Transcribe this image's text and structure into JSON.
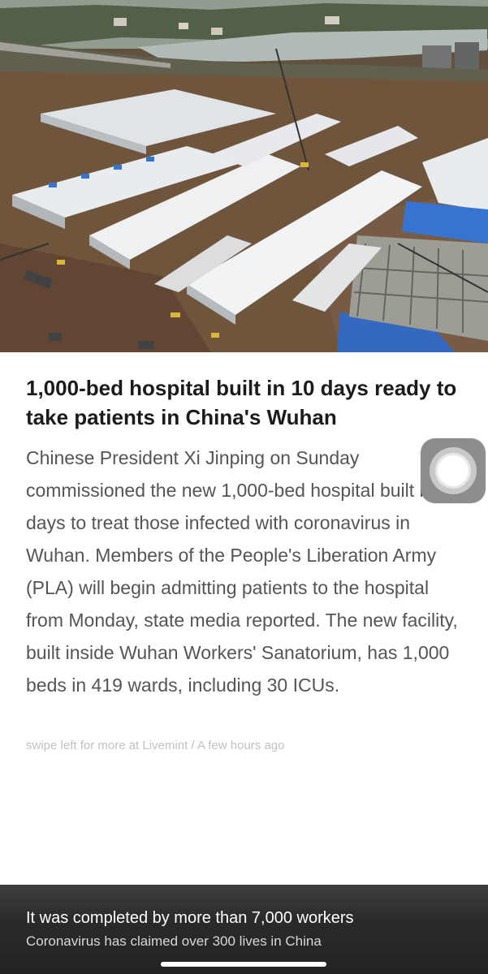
{
  "article": {
    "headline": "1,000-bed hospital built in 10 days ready to take patients in China's Wuhan",
    "body": "Chinese President Xi Jinping on Sunday commissioned the new 1,000-bed hospital built in 10 days to treat those infected with coronavirus in Wuhan. Members of the People's Liberation Army (PLA) will begin admitting patients to the hospital from Monday, state media reported. The new facility, built inside Wuhan Workers' Sanatorium, has 1,000 beds in 419 wards, including 30 ICUs.",
    "source_line": "swipe left for more at Livemint / A few hours ago"
  },
  "banner": {
    "title": "It was completed by more than 7,000 workers",
    "subtitle": "Coronavirus has claimed over 300 lives in China"
  },
  "icons": {
    "assistive_touch": "assistive-touch-icon"
  },
  "colors": {
    "roof_white": "#eef0f2",
    "roof_blue": "#2f6fd1",
    "soil": "#6b4f36",
    "banner_bg": "#2a2a2a"
  }
}
